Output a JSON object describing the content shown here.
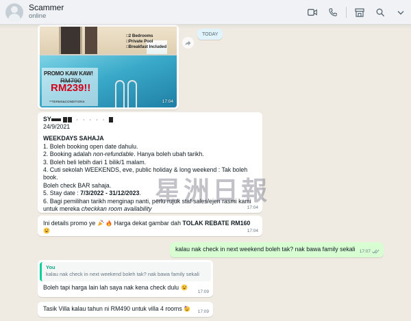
{
  "header": {
    "contact_name": "Scammer",
    "status": "online",
    "icons": [
      "video-call-icon",
      "voice-call-icon",
      "shop-icon",
      "search-icon",
      "chevron-down-icon"
    ]
  },
  "date_pill": "TODAY",
  "image_message": {
    "features": [
      "□2 Bedrooms",
      "□Private Pool",
      "□Breakfast Included"
    ],
    "promo_title": "PROMO KAW KAW!",
    "old_price": "RM790",
    "new_price": "RM239!!",
    "terms": "**TERMS&CONDITIONS",
    "time": "17:04"
  },
  "details_message": {
    "sender_prefix": "SY",
    "date": "24/9/2021",
    "heading": "WEEKDAYS SAHAJA",
    "line1": "1. Boleh booking open date dahulu.",
    "line2_a": "2. Booking adalah ",
    "line2_b": "non-refundable",
    "line2_c": ". Hanya boleh ubah tarikh.",
    "line3": "3. Boleh beli lebih dari 1 bilik/1 malam.",
    "line4": "4. Cuti sekolah WEEKENDS, eve, public holiday & long weekend : Tak boleh book.",
    "line4b": "Boleh check BAR sahaja.",
    "line5_a": "5. Stay date : ",
    "line5_b": "7/3/2022 - 31/12/2023",
    "line5_c": ".",
    "line6": "6. Bagi pemilihan tarikh menginap nanti, perlu rujuk staf sales/ejen rasmi kami",
    "line6b_a": "untuk mereka ",
    "line6b_b": "checkkan room availability",
    "time": "17:04"
  },
  "watermark": "星洲日報",
  "promo_message": {
    "text_a": "Ini details promo ye",
    "text_b": " Harga dekat gambar dah ",
    "text_bold": "TOLAK REBATE RM160",
    "time": "17:04"
  },
  "outgoing_message": {
    "text": "kalau nak check in next weekend boleh tak? nak bawa family sekali",
    "time": "17:07"
  },
  "reply_message": {
    "quote_author": "You",
    "quote_text": "kalau nak check in next weekend boleh tak? nak bawa family sekali",
    "text": "Boleh tapi harga lain lah saya nak kena check dulu",
    "time": "17:09"
  },
  "last_message": {
    "text": "Tasik Villa kalau tahun ni RM490 untuk villa 4 rooms",
    "time": "17:09"
  }
}
